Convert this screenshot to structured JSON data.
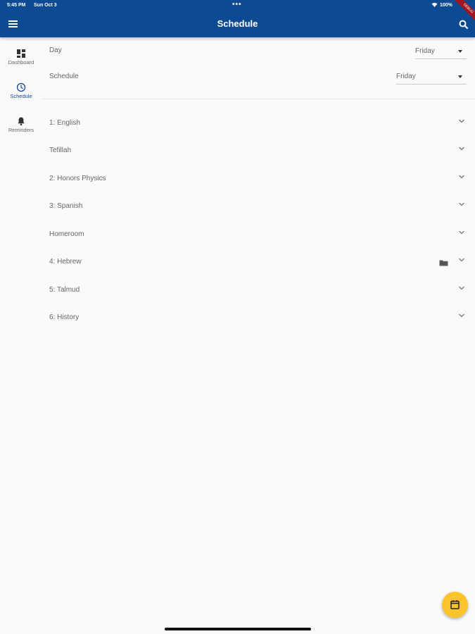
{
  "status_bar": {
    "time": "5:45 PM",
    "date": "Sun Oct 3",
    "dots": "•••",
    "battery": "100%",
    "wifi_icon": "wifi-icon",
    "battery_icon": "battery-icon"
  },
  "debug_ribbon": "DEBUG",
  "app_bar": {
    "title": "Schedule",
    "menu_icon": "menu-icon",
    "search_icon": "search-icon",
    "color": "#0d4a94"
  },
  "rail": {
    "items": [
      {
        "label": "Dashboard",
        "icon": "dashboard-icon",
        "active": false
      },
      {
        "label": "Schedule",
        "icon": "clock-icon",
        "active": true
      },
      {
        "label": "Reminders",
        "icon": "bell-icon",
        "active": false
      }
    ]
  },
  "filters": {
    "day": {
      "label": "Day",
      "value": "Friday"
    },
    "schedule": {
      "label": "Schedule",
      "value": "Friday"
    }
  },
  "periods": [
    {
      "label": "1: English",
      "has_folder": false
    },
    {
      "label": "Tefillah",
      "has_folder": false
    },
    {
      "label": "2: Honors Physics",
      "has_folder": false
    },
    {
      "label": "3: Spanish",
      "has_folder": false
    },
    {
      "label": "Homeroom",
      "has_folder": false
    },
    {
      "label": "4: Hebrew",
      "has_folder": true
    },
    {
      "label": "5: Talmud",
      "has_folder": false
    },
    {
      "label": "6: History",
      "has_folder": false
    }
  ],
  "fab": {
    "icon": "calendar-icon",
    "color": "#fcc32c"
  }
}
